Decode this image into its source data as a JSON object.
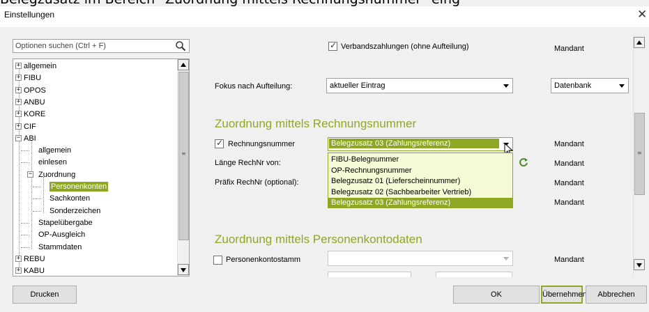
{
  "caption": "Belegzusatz im Bereich \"Zuordnung mittels Rechnungsnummer\" eing",
  "window": {
    "title": "Einstellungen",
    "close_glyph": "✕"
  },
  "search": {
    "placeholder": "Optionen suchen (Ctrl + F)"
  },
  "tree": {
    "nodes": [
      {
        "label": "allgemein",
        "expander": "+"
      },
      {
        "label": "FIBU",
        "expander": "+"
      },
      {
        "label": "OPOS",
        "expander": "+"
      },
      {
        "label": "ANBU",
        "expander": "+"
      },
      {
        "label": "KORE",
        "expander": "+"
      },
      {
        "label": "CIF",
        "expander": "+"
      },
      {
        "label": "ABI",
        "expander": "−"
      },
      {
        "label": "allgemein"
      },
      {
        "label": "einlesen"
      },
      {
        "label": "Zuordnung",
        "expander": "−"
      },
      {
        "label": "Personenkonten",
        "selected": true
      },
      {
        "label": "Sachkonten"
      },
      {
        "label": "Sonderzeichen"
      },
      {
        "label": "Stapelübergabe"
      },
      {
        "label": "OP-Ausgleich"
      },
      {
        "label": "Stammdaten"
      },
      {
        "label": "REBU",
        "expander": "+"
      },
      {
        "label": "KABU",
        "expander": "+"
      }
    ]
  },
  "settings": {
    "verbandszahlungen": {
      "label": "Verbandszahlungen (ohne Aufteilung)",
      "checked": true,
      "scope": "Mandant"
    },
    "fokus": {
      "label": "Fokus nach Aufteilung:",
      "value": "aktueller Eintrag",
      "scope_value": "Datenbank"
    },
    "section_rechnungsnummer": "Zuordnung mittels Rechnungsnummer",
    "rechnungsnummer": {
      "label": "Rechnungsnummer",
      "checked": true,
      "value": "Belegzusatz 03 (Zahlungsreferenz)",
      "scope": "Mandant"
    },
    "laenge": {
      "label": "Länge RechNr von:",
      "scope": "Mandant"
    },
    "praefix": {
      "label": "Präfix RechNr (optional):",
      "scope": "Mandant"
    },
    "extra_scope": "Mandant",
    "dropdown_options": [
      "FIBU-Belegnummer",
      "OP-Rechnungsnummer",
      "Belegzusatz 01 (Lieferscheinnummer)",
      "Belegzusatz 02 (Sachbearbeiter Vertrieb)",
      "Belegzusatz 03 (Zahlungsreferenz)"
    ],
    "dropdown_selected_index": 4,
    "section_personenkonto": "Zuordnung mittels Personenkontodaten",
    "personenkontostamm": {
      "label": "Personenkontostamm",
      "checked": false,
      "value": "",
      "scope": "Mandant"
    }
  },
  "buttons": {
    "print": "Drucken",
    "ok": "OK",
    "apply": "Übernehmen",
    "cancel": "Abbrechen"
  },
  "colors": {
    "accent": "#8ea826",
    "dropdown_bg": "#f5f9d6"
  }
}
